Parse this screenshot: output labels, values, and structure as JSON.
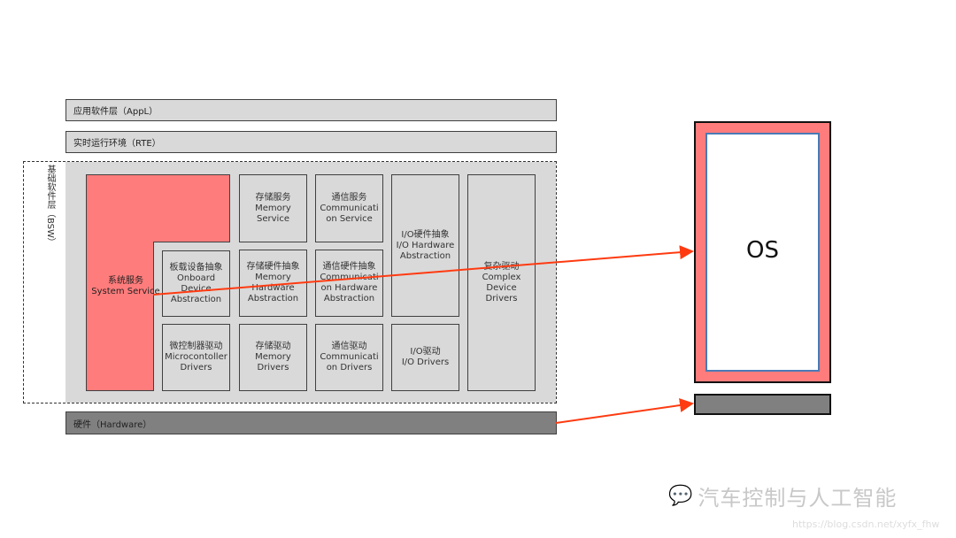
{
  "layers": {
    "appl": "应用软件层（AppL）",
    "rte": "实时运行环境（RTE）",
    "bsw": "基础软件层（BSW）",
    "hardware": "硬件（Hardware）"
  },
  "modules": {
    "system_service": {
      "cn": "系统服务",
      "en": "System Service"
    },
    "onboard": {
      "cn": "板载设备抽象",
      "en": "Onboard Device Abstraction"
    },
    "micro": {
      "cn": "微控制器驱动",
      "en": "Microcontoller Drivers"
    },
    "mem_service": {
      "cn": "存储服务",
      "en": "Memory Service"
    },
    "mem_hw": {
      "cn": "存储硬件抽象",
      "en": "Memory Hardware Abstraction"
    },
    "mem_drv": {
      "cn": "存储驱动",
      "en": "Memory Drivers"
    },
    "com_service": {
      "cn": "通信服务",
      "en": "Communication Service"
    },
    "com_hw": {
      "cn": "通信硬件抽象",
      "en": "Communication Hardware Abstraction"
    },
    "com_drv": {
      "cn": "通信驱动",
      "en": "Communication Drivers"
    },
    "io_hw": {
      "cn": "I/O硬件抽象",
      "en": "I/O Hardware Abstraction"
    },
    "io_drv": {
      "cn": "I/O驱动",
      "en": "I/O Drivers"
    },
    "complex": {
      "cn": "复杂驱动",
      "en": "Complex Device Drivers"
    }
  },
  "os": {
    "label": "OS"
  },
  "watermark": {
    "title": "汽车控制与人工智能",
    "url": "https://blog.csdn.net/xyfx_fhw"
  },
  "colors": {
    "red": "#ff7c7c",
    "gray": "#d9d9d9",
    "dark_gray": "#808080",
    "arrow": "#ff3a10",
    "os_inner_border": "#4a7ab5"
  }
}
